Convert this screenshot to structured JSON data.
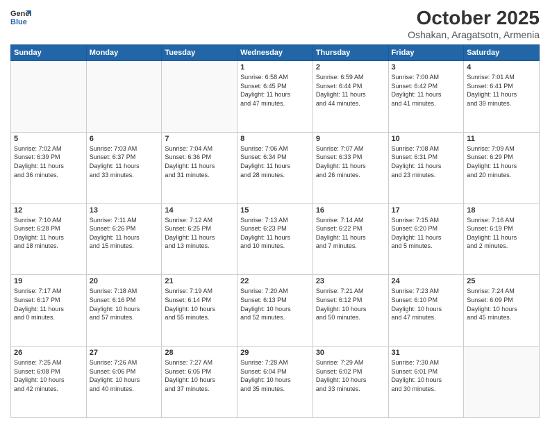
{
  "logo": {
    "line1": "General",
    "line2": "Blue"
  },
  "title": "October 2025",
  "location": "Oshakan, Aragatsotn, Armenia",
  "weekdays": [
    "Sunday",
    "Monday",
    "Tuesday",
    "Wednesday",
    "Thursday",
    "Friday",
    "Saturday"
  ],
  "days": [
    {
      "date": "",
      "content": ""
    },
    {
      "date": "",
      "content": ""
    },
    {
      "date": "",
      "content": ""
    },
    {
      "date": "1",
      "content": "Sunrise: 6:58 AM\nSunset: 6:45 PM\nDaylight: 11 hours\nand 47 minutes."
    },
    {
      "date": "2",
      "content": "Sunrise: 6:59 AM\nSunset: 6:44 PM\nDaylight: 11 hours\nand 44 minutes."
    },
    {
      "date": "3",
      "content": "Sunrise: 7:00 AM\nSunset: 6:42 PM\nDaylight: 11 hours\nand 41 minutes."
    },
    {
      "date": "4",
      "content": "Sunrise: 7:01 AM\nSunset: 6:41 PM\nDaylight: 11 hours\nand 39 minutes."
    },
    {
      "date": "5",
      "content": "Sunrise: 7:02 AM\nSunset: 6:39 PM\nDaylight: 11 hours\nand 36 minutes."
    },
    {
      "date": "6",
      "content": "Sunrise: 7:03 AM\nSunset: 6:37 PM\nDaylight: 11 hours\nand 33 minutes."
    },
    {
      "date": "7",
      "content": "Sunrise: 7:04 AM\nSunset: 6:36 PM\nDaylight: 11 hours\nand 31 minutes."
    },
    {
      "date": "8",
      "content": "Sunrise: 7:06 AM\nSunset: 6:34 PM\nDaylight: 11 hours\nand 28 minutes."
    },
    {
      "date": "9",
      "content": "Sunrise: 7:07 AM\nSunset: 6:33 PM\nDaylight: 11 hours\nand 26 minutes."
    },
    {
      "date": "10",
      "content": "Sunrise: 7:08 AM\nSunset: 6:31 PM\nDaylight: 11 hours\nand 23 minutes."
    },
    {
      "date": "11",
      "content": "Sunrise: 7:09 AM\nSunset: 6:29 PM\nDaylight: 11 hours\nand 20 minutes."
    },
    {
      "date": "12",
      "content": "Sunrise: 7:10 AM\nSunset: 6:28 PM\nDaylight: 11 hours\nand 18 minutes."
    },
    {
      "date": "13",
      "content": "Sunrise: 7:11 AM\nSunset: 6:26 PM\nDaylight: 11 hours\nand 15 minutes."
    },
    {
      "date": "14",
      "content": "Sunrise: 7:12 AM\nSunset: 6:25 PM\nDaylight: 11 hours\nand 13 minutes."
    },
    {
      "date": "15",
      "content": "Sunrise: 7:13 AM\nSunset: 6:23 PM\nDaylight: 11 hours\nand 10 minutes."
    },
    {
      "date": "16",
      "content": "Sunrise: 7:14 AM\nSunset: 6:22 PM\nDaylight: 11 hours\nand 7 minutes."
    },
    {
      "date": "17",
      "content": "Sunrise: 7:15 AM\nSunset: 6:20 PM\nDaylight: 11 hours\nand 5 minutes."
    },
    {
      "date": "18",
      "content": "Sunrise: 7:16 AM\nSunset: 6:19 PM\nDaylight: 11 hours\nand 2 minutes."
    },
    {
      "date": "19",
      "content": "Sunrise: 7:17 AM\nSunset: 6:17 PM\nDaylight: 11 hours\nand 0 minutes."
    },
    {
      "date": "20",
      "content": "Sunrise: 7:18 AM\nSunset: 6:16 PM\nDaylight: 10 hours\nand 57 minutes."
    },
    {
      "date": "21",
      "content": "Sunrise: 7:19 AM\nSunset: 6:14 PM\nDaylight: 10 hours\nand 55 minutes."
    },
    {
      "date": "22",
      "content": "Sunrise: 7:20 AM\nSunset: 6:13 PM\nDaylight: 10 hours\nand 52 minutes."
    },
    {
      "date": "23",
      "content": "Sunrise: 7:21 AM\nSunset: 6:12 PM\nDaylight: 10 hours\nand 50 minutes."
    },
    {
      "date": "24",
      "content": "Sunrise: 7:23 AM\nSunset: 6:10 PM\nDaylight: 10 hours\nand 47 minutes."
    },
    {
      "date": "25",
      "content": "Sunrise: 7:24 AM\nSunset: 6:09 PM\nDaylight: 10 hours\nand 45 minutes."
    },
    {
      "date": "26",
      "content": "Sunrise: 7:25 AM\nSunset: 6:08 PM\nDaylight: 10 hours\nand 42 minutes."
    },
    {
      "date": "27",
      "content": "Sunrise: 7:26 AM\nSunset: 6:06 PM\nDaylight: 10 hours\nand 40 minutes."
    },
    {
      "date": "28",
      "content": "Sunrise: 7:27 AM\nSunset: 6:05 PM\nDaylight: 10 hours\nand 37 minutes."
    },
    {
      "date": "29",
      "content": "Sunrise: 7:28 AM\nSunset: 6:04 PM\nDaylight: 10 hours\nand 35 minutes."
    },
    {
      "date": "30",
      "content": "Sunrise: 7:29 AM\nSunset: 6:02 PM\nDaylight: 10 hours\nand 33 minutes."
    },
    {
      "date": "31",
      "content": "Sunrise: 7:30 AM\nSunset: 6:01 PM\nDaylight: 10 hours\nand 30 minutes."
    },
    {
      "date": "",
      "content": ""
    }
  ]
}
